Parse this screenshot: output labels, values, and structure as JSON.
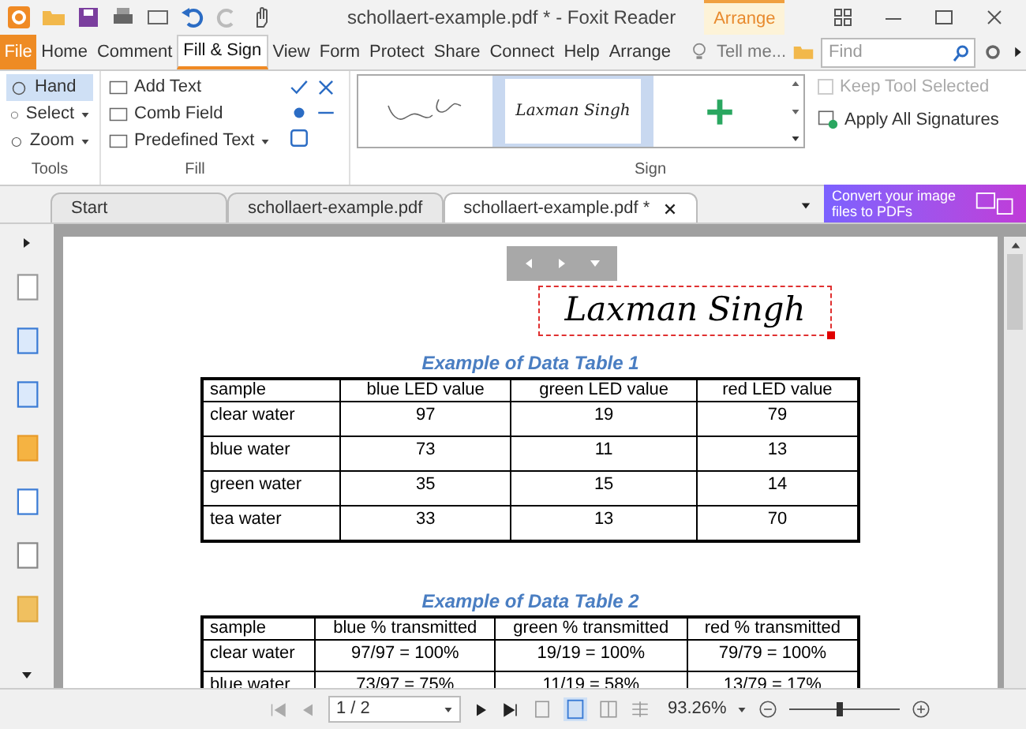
{
  "window": {
    "title": "schollaert-example.pdf * - Foxit Reader",
    "context_tab": "Arrange"
  },
  "menu_tabs": [
    {
      "label": "File",
      "kind": "file",
      "selected": false
    },
    {
      "label": "Home",
      "kind": "tab",
      "selected": false
    },
    {
      "label": "Comment",
      "kind": "tab",
      "selected": false
    },
    {
      "label": "Fill & Sign",
      "kind": "tab",
      "selected": true
    },
    {
      "label": "View",
      "kind": "tab",
      "selected": false
    },
    {
      "label": "Form",
      "kind": "tab",
      "selected": false
    },
    {
      "label": "Protect",
      "kind": "tab",
      "selected": false
    },
    {
      "label": "Share",
      "kind": "tab",
      "selected": false
    },
    {
      "label": "Connect",
      "kind": "tab",
      "selected": false
    },
    {
      "label": "Help",
      "kind": "tab",
      "selected": false
    },
    {
      "label": "Arrange",
      "kind": "tab",
      "selected": false
    }
  ],
  "tell_me": "Tell me...",
  "search": {
    "placeholder": "Find"
  },
  "ribbon": {
    "tools": {
      "label": "Tools",
      "items": [
        {
          "label": "Hand",
          "selected": true,
          "dropdown": false
        },
        {
          "label": "Select",
          "selected": false,
          "dropdown": true
        },
        {
          "label": "Zoom",
          "selected": false,
          "dropdown": true
        }
      ]
    },
    "fill": {
      "label": "Fill",
      "items": [
        {
          "label": "Add Text",
          "dropdown": false
        },
        {
          "label": "Comb Field",
          "dropdown": false
        },
        {
          "label": "Predefined Text",
          "dropdown": true
        }
      ]
    },
    "sign": {
      "label": "Sign",
      "signatures": [
        {
          "kind": "handwritten",
          "selected": false
        },
        {
          "kind": "typed",
          "text": "Laxman Singh",
          "selected": true
        },
        {
          "kind": "add",
          "selected": false
        }
      ]
    },
    "keep_tool_selected": {
      "label": "Keep Tool Selected",
      "checked": false,
      "disabled": true
    },
    "apply_all": "Apply All Signatures"
  },
  "doc_tabs": [
    {
      "label": "Start",
      "selected": false,
      "closable": false
    },
    {
      "label": "schollaert-example.pdf",
      "selected": false,
      "closable": false
    },
    {
      "label": "schollaert-example.pdf *",
      "selected": true,
      "closable": true
    }
  ],
  "promo": "Convert your image files to PDFs",
  "page": {
    "signature": "Laxman Singh",
    "tables": [
      {
        "title": "Example of Data Table 1",
        "columns": [
          "sample",
          "blue LED value",
          "green LED value",
          "red LED value"
        ],
        "rows": [
          [
            "clear water",
            "97",
            "19",
            "79"
          ],
          [
            "blue water",
            "73",
            "11",
            "13"
          ],
          [
            "green water",
            "35",
            "15",
            "14"
          ],
          [
            "tea water",
            "33",
            "13",
            "70"
          ]
        ]
      },
      {
        "title": "Example of Data Table 2",
        "columns": [
          "sample",
          "blue % transmitted",
          "green % transmitted",
          "red % transmitted"
        ],
        "rows": [
          [
            "clear water",
            "97/97 = 100%",
            "19/19 = 100%",
            "79/79 = 100%"
          ],
          [
            "blue water",
            "73/97 = 75%",
            "11/19 = 58%",
            "13/79 = 17%"
          ]
        ]
      }
    ]
  },
  "status_bar": {
    "page": "1 / 2",
    "zoom": "93.26%",
    "zoom_slider": {
      "level": 0.45
    }
  }
}
